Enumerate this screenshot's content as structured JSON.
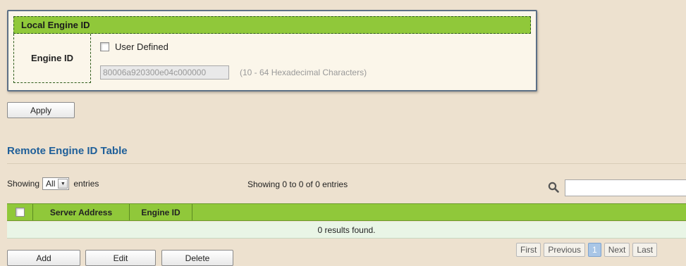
{
  "local_engine": {
    "title": "Local Engine ID",
    "label": "Engine ID",
    "user_defined_label": "User Defined",
    "engine_id_value": "80006a920300e04c000000",
    "hint": "(10 - 64 Hexadecimal Characters)"
  },
  "apply_label": "Apply",
  "remote": {
    "title": "Remote Engine ID Table",
    "showing_label": "Showing",
    "entries_select": "All",
    "entries_label": "entries",
    "showing_info": "Showing 0 to 0 of 0 entries",
    "columns": [
      "Server Address",
      "Engine ID"
    ],
    "empty_message": "0 results found."
  },
  "buttons": {
    "add": "Add",
    "edit": "Edit",
    "delete": "Delete"
  },
  "pagination": {
    "first": "First",
    "previous": "Previous",
    "page": "1",
    "next": "Next",
    "last": "Last"
  },
  "colors": {
    "header_green": "#90c83a",
    "title_blue": "#1f5f99",
    "background": "#ede1cf"
  },
  "icons": {
    "search": "search-icon",
    "dropdown": "chevron-down-icon",
    "checkbox": "checkbox"
  }
}
